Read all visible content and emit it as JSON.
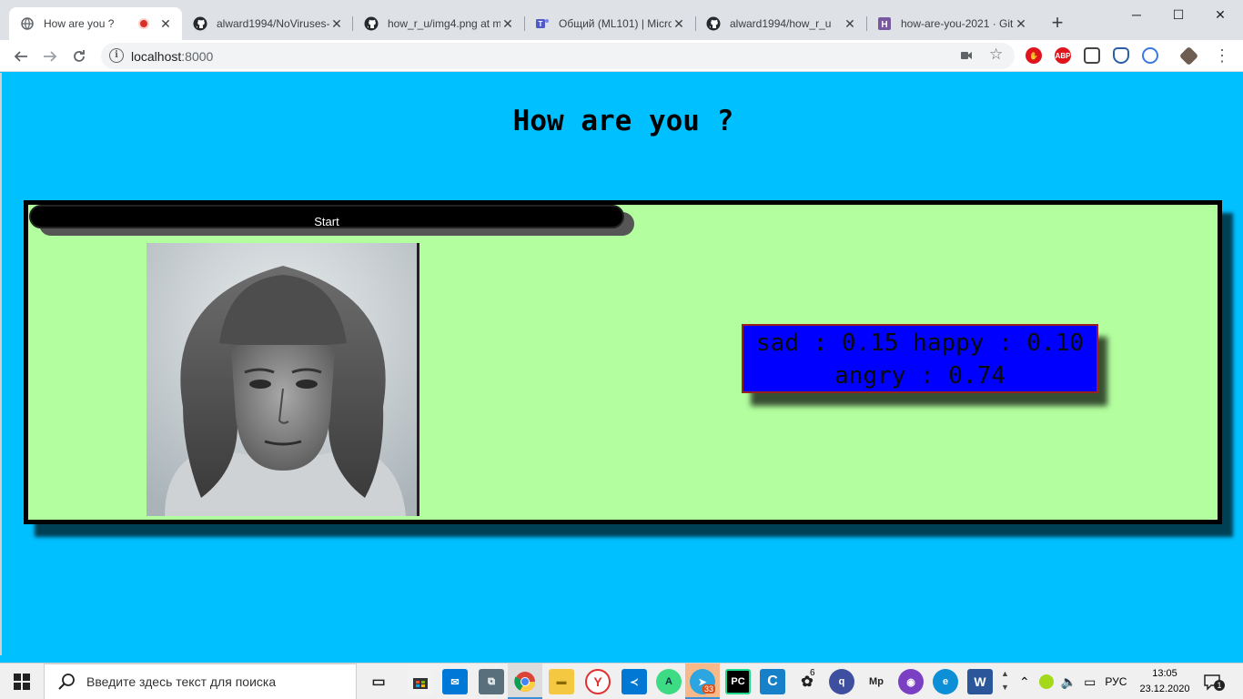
{
  "browser": {
    "tabs": [
      {
        "title": "How are you ?",
        "icon": "globe-icon",
        "recording": true
      },
      {
        "title": "alward1994/NoViruses-",
        "icon": "github-icon"
      },
      {
        "title": "how_r_u/img4.png at m",
        "icon": "github-icon"
      },
      {
        "title": "Общий (ML101) | Micro",
        "icon": "teams-icon"
      },
      {
        "title": "alward1994/how_r_u",
        "icon": "github-icon"
      },
      {
        "title": "how-are-you-2021 · Git",
        "icon": "heroku-icon"
      }
    ],
    "new_tab": "+",
    "window_controls": {
      "minimize": "─",
      "maximize": "☐",
      "close": "✕"
    },
    "url_host": "localhost",
    "url_port": ":8000"
  },
  "page": {
    "title": "How are you ?",
    "start_button": "Start",
    "result_line1": "sad : 0.15 happy : 0.10",
    "result_line2": "angry : 0.74",
    "colors": {
      "background": "#00c0ff",
      "panel": "#b3ff9f",
      "result": "#0000ff"
    }
  },
  "taskbar": {
    "search_placeholder": "Введите здесь текст для поиска",
    "telegram_badge": "33",
    "icq_badge": "6",
    "language": "РУС",
    "time": "13:05",
    "date": "23.12.2020",
    "notification_count": "1"
  }
}
